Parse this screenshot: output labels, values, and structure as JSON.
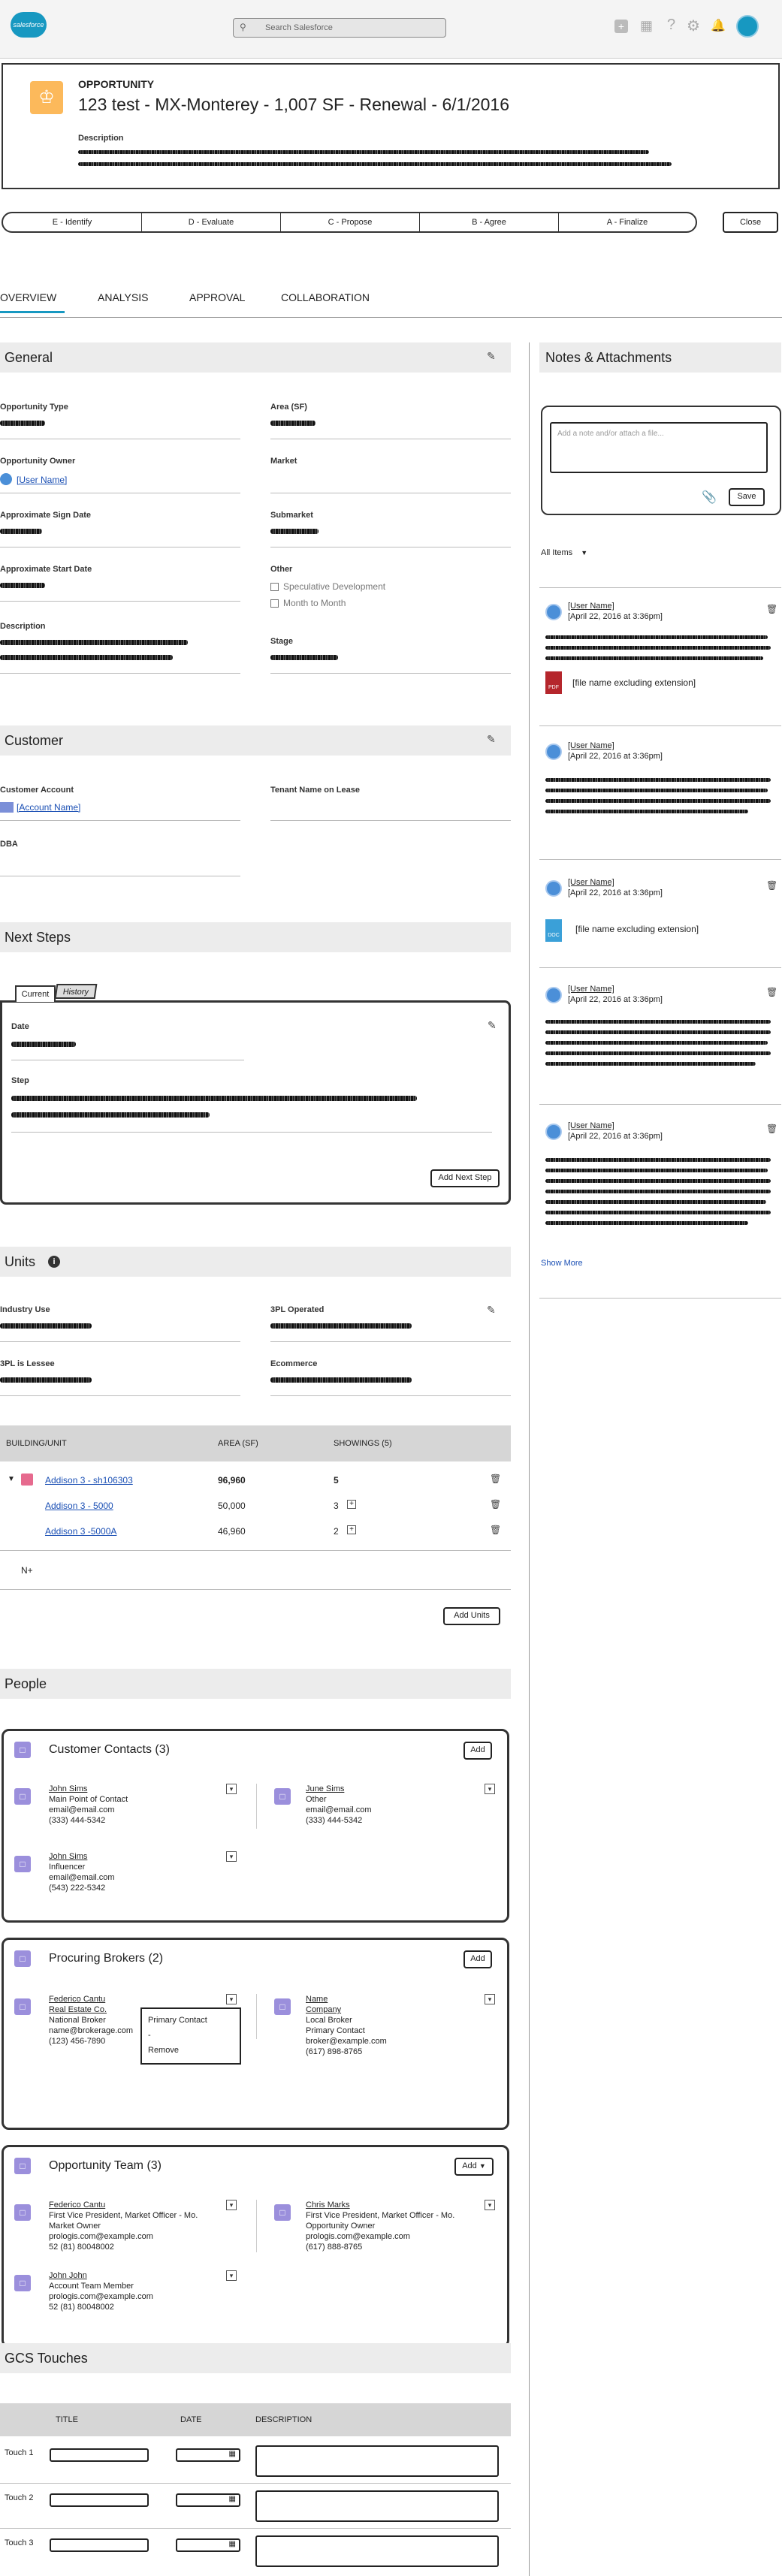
{
  "app": {
    "logo": "salesforce",
    "search_placeholder": "Search Salesforce",
    "header_icons": [
      "plus-icon",
      "grid-icon",
      "help-icon",
      "gear-icon",
      "bell-icon",
      "avatar"
    ]
  },
  "record": {
    "type_label": "OPPORTUNITY",
    "title": "123 test - MX-Monterey - 1,007 SF - Renewal - 6/1/2016",
    "description_label": "Description"
  },
  "path": {
    "stages": [
      "E - Identify",
      "D - Evaluate",
      "C - Propose",
      "B - Agree",
      "A - Finalize"
    ],
    "close_label": "Close"
  },
  "tabs": [
    "OVERVIEW",
    "ANALYSIS",
    "APPROVAL",
    "COLLABORATION"
  ],
  "general": {
    "title": "General",
    "opportunity_type": "Opportunity Type",
    "area_sf": "Area (SF)",
    "opportunity_owner": "Opportunity Owner",
    "owner_value": "[User Name]",
    "market": "Market",
    "approx_sign_date": "Approximate Sign Date",
    "submarket": "Submarket",
    "approx_start_date": "Approximate Start Date",
    "other": "Other",
    "speculative": "Speculative Development",
    "month_to_month": "Month to Month",
    "description": "Description",
    "stage": "Stage"
  },
  "customer": {
    "title": "Customer",
    "customer_account": "Customer Account",
    "account_value": "[Account Name]",
    "tenant_name": "Tenant Name on Lease",
    "dba": "DBA"
  },
  "next_steps": {
    "title": "Next Steps",
    "tab_current": "Current",
    "tab_history": "History",
    "date": "Date",
    "step": "Step",
    "add_button": "Add Next Step"
  },
  "units": {
    "title": "Units",
    "industry_use": "Industry Use",
    "threepl_operated": "3PL Operated",
    "threepl_lessee": "3PL is Lessee",
    "ecommerce": "Ecommerce",
    "columns": [
      "BUILDING/UNIT",
      "AREA (SF)",
      "SHOWINGS (5)"
    ],
    "rows": [
      {
        "name": "Addison 3 - sh106303",
        "area": "96,960",
        "showings": "5"
      },
      {
        "name": "Addison 3 - 5000",
        "area": "50,000",
        "showings": "3"
      },
      {
        "name": "Addison 3 -5000A",
        "area": "46,960",
        "showings": "2"
      }
    ],
    "na_label": "N+",
    "add_button": "Add Units"
  },
  "people": {
    "title": "People",
    "customer_contacts": {
      "title": "Customer Contacts (3)",
      "add": "Add",
      "contacts": [
        {
          "name": "John Sims",
          "lines": [
            "Main Point of Contact",
            "email@email.com",
            "(333) 444-5342"
          ]
        },
        {
          "name": "June Sims",
          "lines": [
            "Other",
            "email@email.com",
            "(333) 444-5342"
          ]
        },
        {
          "name": "John Sims",
          "lines": [
            "Influencer",
            "email@email.com",
            "(543) 222-5342"
          ]
        }
      ]
    },
    "procuring_brokers": {
      "title": "Procuring Brokers (2)",
      "add": "Add",
      "brokers": [
        {
          "name": "Federico Cantu",
          "company": "Real Estate Co.",
          "lines": [
            "National Broker",
            "name@brokerage.com",
            "(123) 456-7890"
          ]
        },
        {
          "name": "Name",
          "company": "Company",
          "lines": [
            "Local Broker",
            "Primary Contact",
            "broker@example.com",
            "(617) 898-8765"
          ]
        }
      ],
      "menu": [
        "Primary Contact",
        "-",
        "Remove"
      ]
    },
    "opportunity_team": {
      "title": "Opportunity Team (3)",
      "add": "Add",
      "members": [
        {
          "name": "Federico Cantu",
          "lines": [
            "First Vice President, Market Officer - Mo.",
            "Market Owner",
            "prologis.com@example.com",
            "52 (81) 80048002"
          ]
        },
        {
          "name": "Chris Marks",
          "lines": [
            "First Vice President, Market Officer - Mo.",
            "Opportunity Owner",
            "prologis.com@example.com",
            "(617) 888-8765"
          ]
        },
        {
          "name": "John John",
          "lines": [
            "Account Team Member",
            "prologis.com@example.com",
            "52 (81) 80048002"
          ]
        }
      ]
    }
  },
  "gcs": {
    "title": "GCS Touches",
    "columns": [
      "TITLE",
      "DATE",
      "DESCRIPTION"
    ],
    "rows": [
      "Touch 1",
      "Touch 2",
      "Touch 3"
    ]
  },
  "notes": {
    "title": "Notes & Attachments",
    "placeholder": "Add a note and/or attach a file...",
    "save": "Save",
    "filter": "All Items",
    "items": [
      {
        "user": "[User Name]",
        "date": "[April 22, 2016 at 3:36pm]",
        "file": "[file name excluding extension]",
        "file_type": "PDF"
      },
      {
        "user": "[User Name]",
        "date": "[April 22, 2016 at 3:36pm]"
      },
      {
        "user": "[User Name]",
        "date": "[April 22, 2016 at 3:36pm]",
        "file": "[file name excluding extension]",
        "file_type": "DOC"
      },
      {
        "user": "[User Name]",
        "date": "[April 22, 2016 at 3:36pm]"
      },
      {
        "user": "[User Name]",
        "date": "[April 22, 2016 at 3:36pm]"
      }
    ],
    "show_more": "Show More"
  },
  "colors": {
    "brand": "#1798c1",
    "opp_icon": "#fcb95b",
    "link": "#1a4fb4",
    "pdf": "#b5262c",
    "doc": "#3aa0d8",
    "contact_icon": "#9b8fdc"
  }
}
